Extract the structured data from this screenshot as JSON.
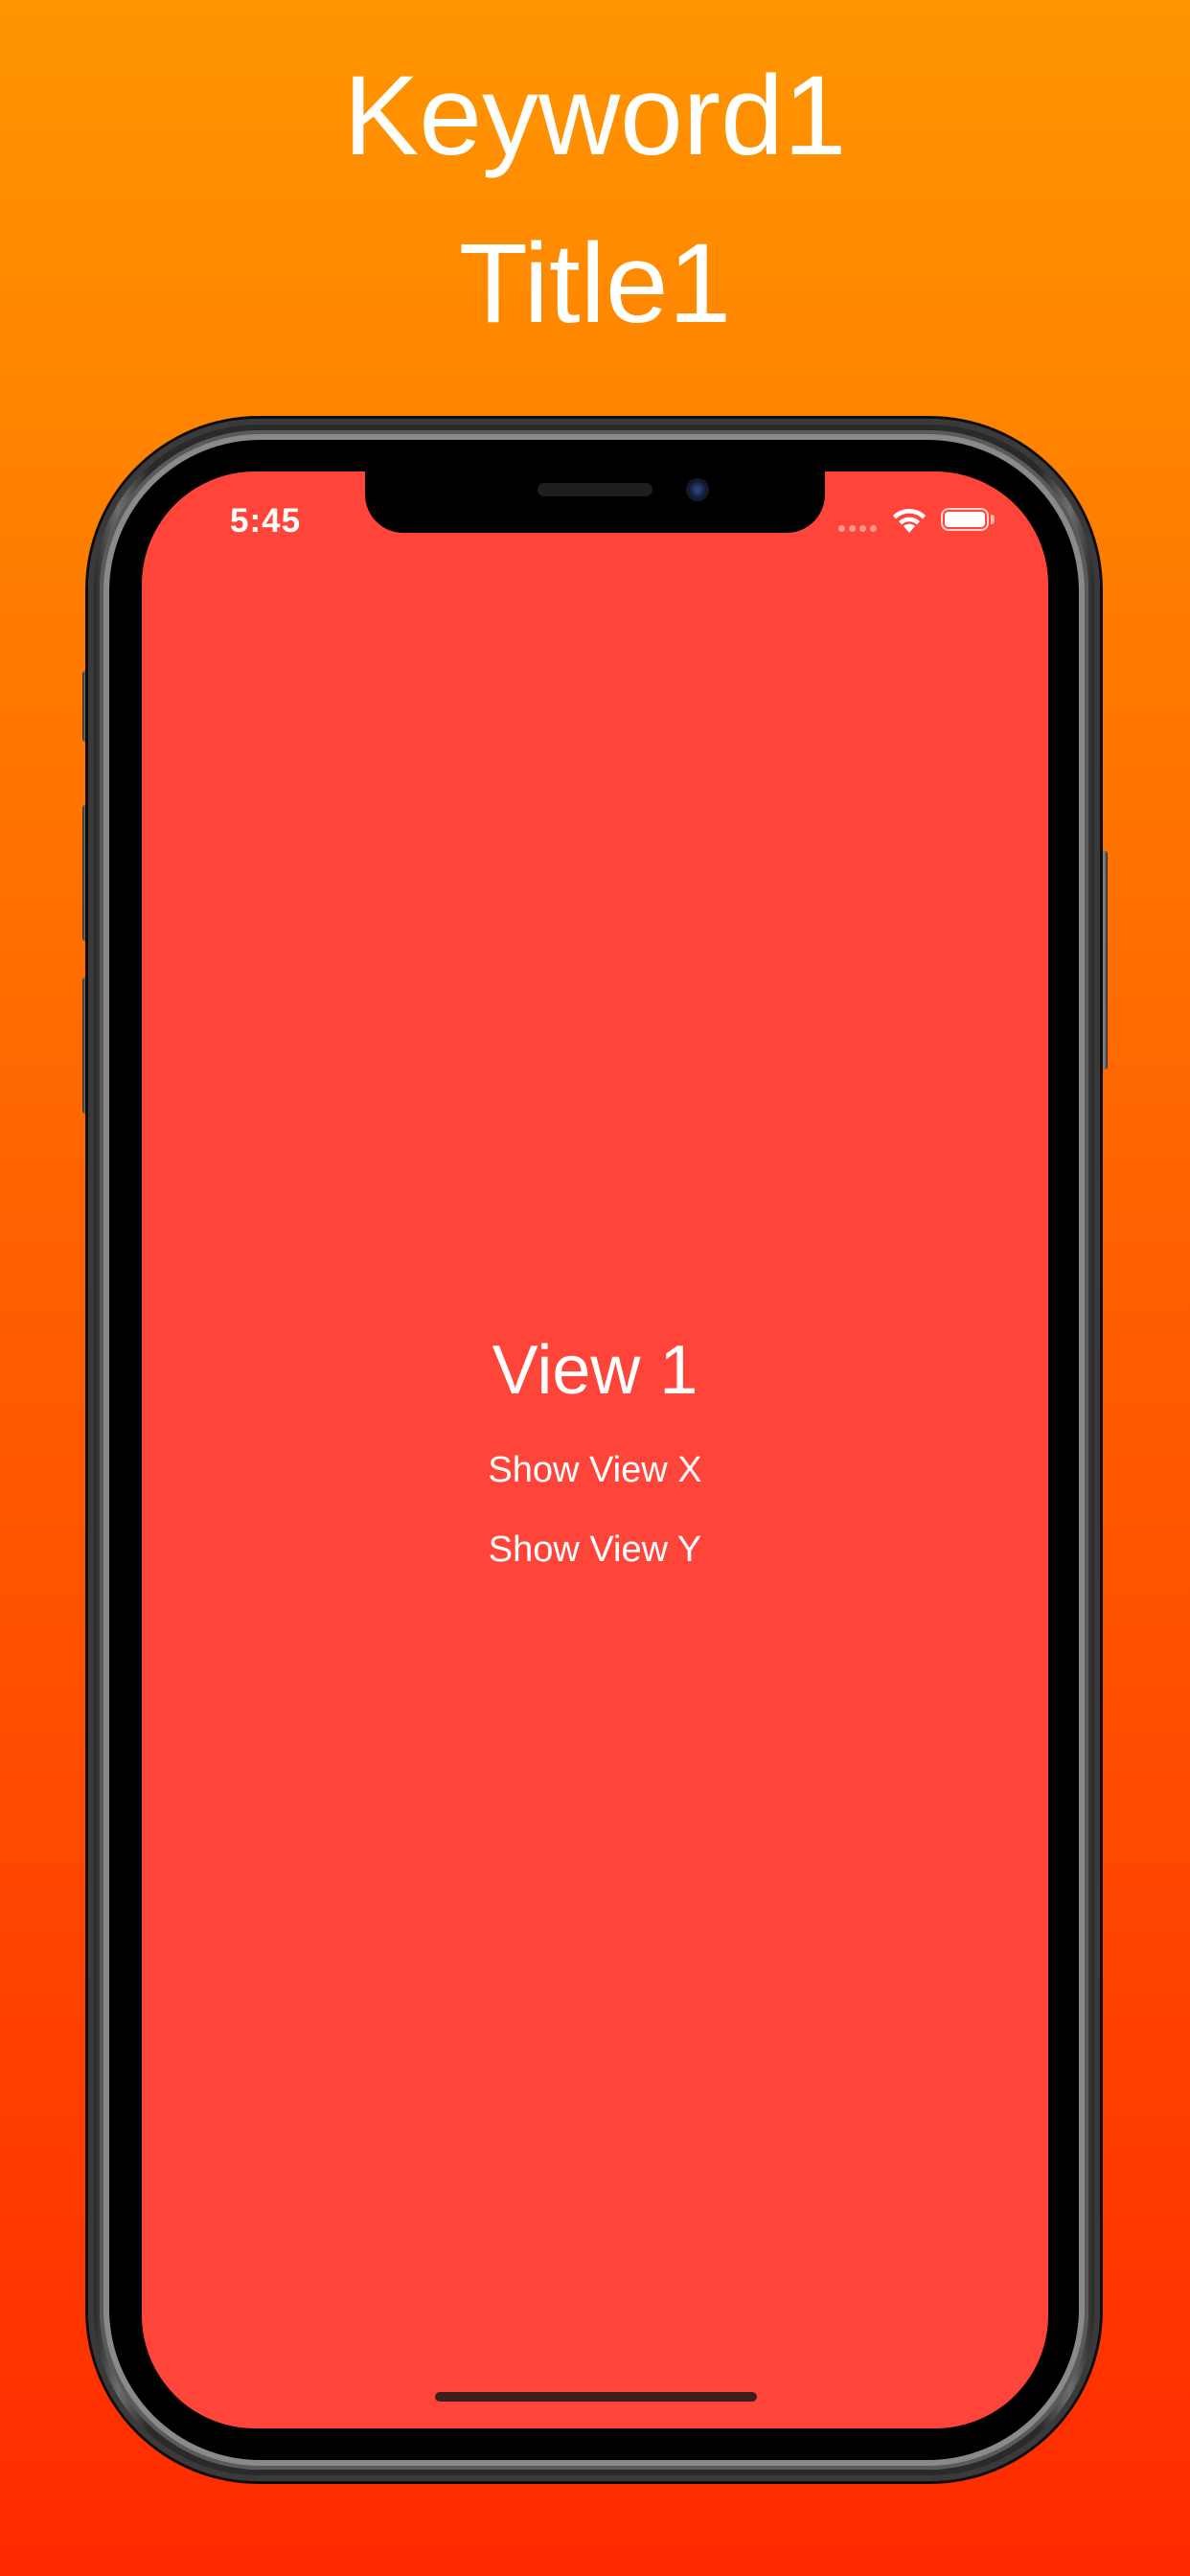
{
  "header": {
    "keyword": "Keyword1",
    "title": "Title1"
  },
  "status_bar": {
    "time": "5:45",
    "battery_level": 1.0
  },
  "screen": {
    "background": "#ff453a",
    "view_title": "View 1",
    "buttons": [
      {
        "label": "Show View X"
      },
      {
        "label": "Show View Y"
      }
    ]
  },
  "colors": {
    "gradient_top": "#ff9500",
    "gradient_bottom": "#ff2a00",
    "text": "#ffffff"
  }
}
